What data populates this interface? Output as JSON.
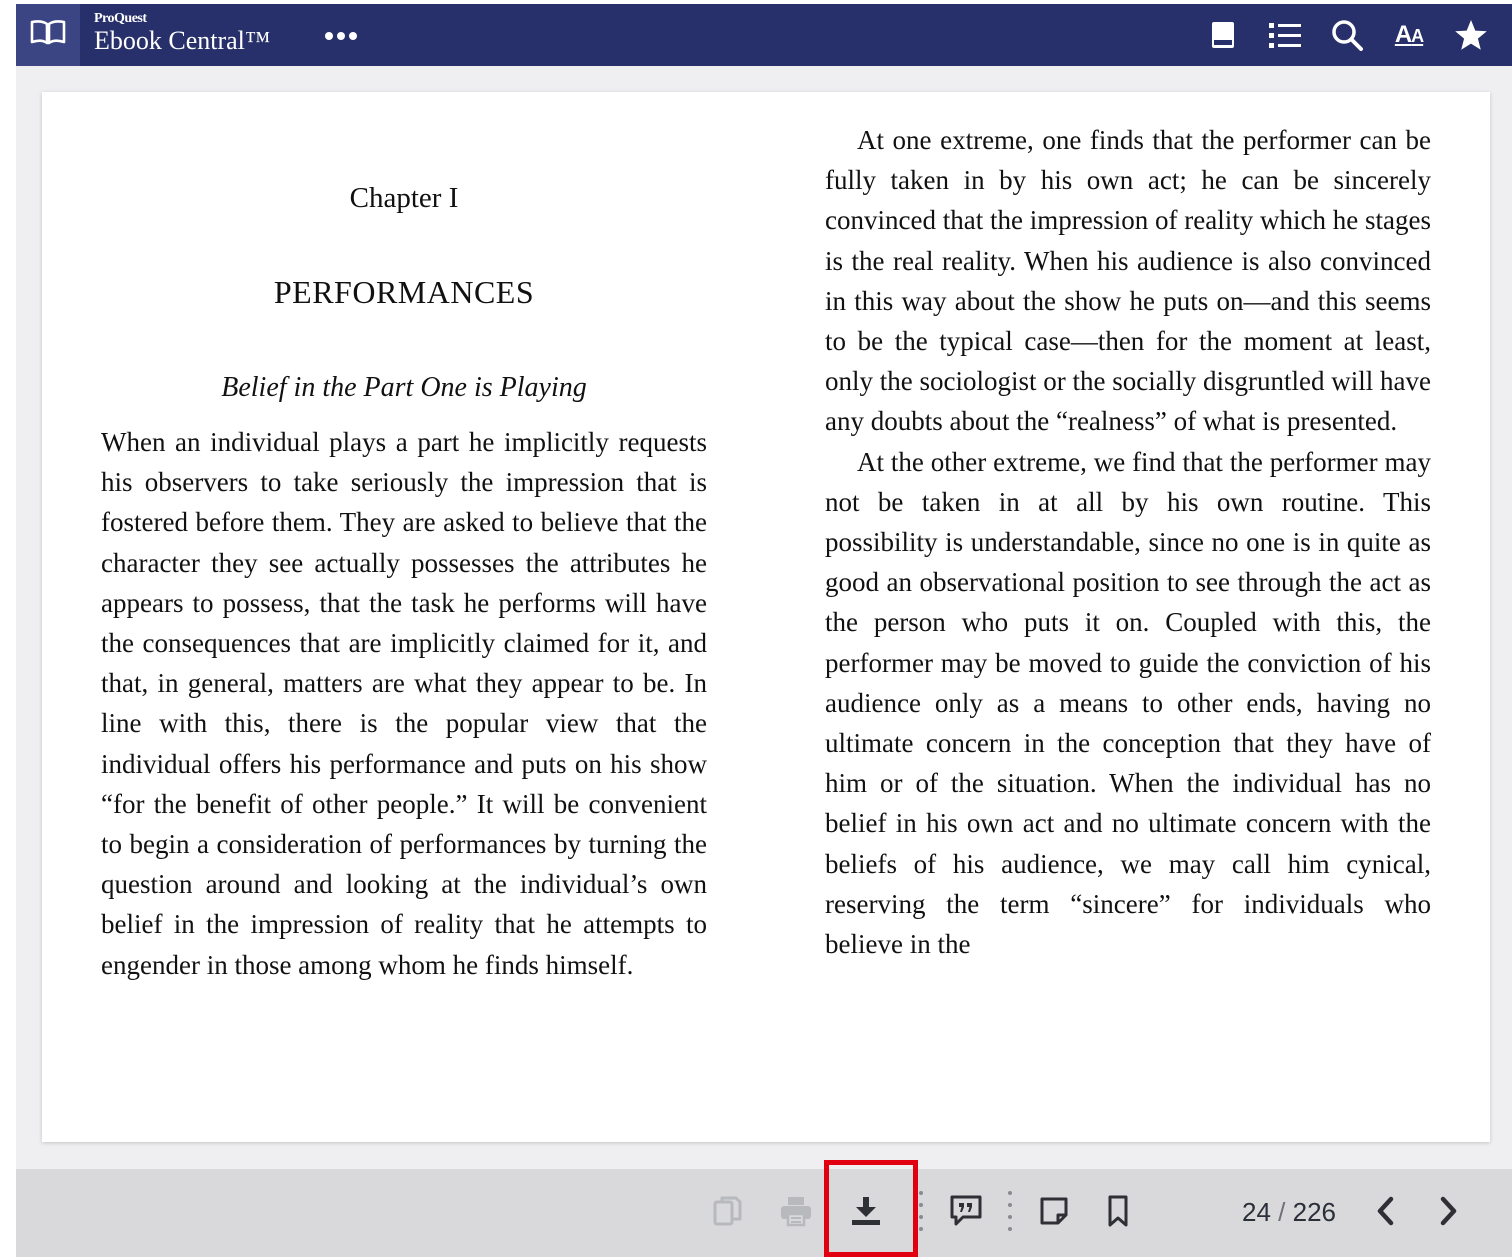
{
  "header": {
    "brand_small": "ProQuest",
    "brand_big": "Ebook Central™",
    "more_label": "•••",
    "icons": [
      "book-view-icon",
      "table-of-contents-icon",
      "search-icon",
      "text-size-icon",
      "favorite-star-icon"
    ],
    "text_size_label": "A",
    "text_size_label_small": "A"
  },
  "page": {
    "chapter_number": "Chapter I",
    "chapter_title": "PERFORMANCES",
    "section_title": "Belief in the Part One is Playing",
    "left_paragraph": "When an individual plays a part he implicitly requests his observers to take seriously the impression that is fostered before them. They are asked to believe that the character they see actually possesses the attributes he appears to possess, that the task he performs will have the consequences that are implicitly claimed for it, and that, in general, matters are what they appear to be. In line with this, there is the popular view that the individual offers his performance and puts on his show “for the benefit of other people.” It will be convenient to begin a consideration of performances by turning the question around and looking at the individual’s own belief in the impression of reality that he attempts to engender in those among whom he finds himself.",
    "right_paragraph_1": "At one extreme, one finds that the performer can be fully taken in by his own act; he can be sincerely convinced that the impression of reality which he stages is the real reality. When his audience is also convinced in this way about the show he puts on—and this seems to be the typical case—then for the moment at least, only the sociologist or the socially disgruntled will have any doubts about the “realness” of what is presented.",
    "right_paragraph_2": "At the other extreme, we find that the performer may not be taken in at all by his own routine. This possibility is understandable, since no one is in quite as good an observational position to see through the act as the person who puts it on. Coupled with this, the performer may be moved to guide the conviction of his audience only as a means to other ends, having no ultimate concern in the conception that they have of him or of the situation. When the individual has no belief in his own act and no ultimate concern with the beliefs of his audience, we may call him cynical, reserving the term “sincere” for individuals who believe in the"
  },
  "toolbar": {
    "icons": [
      "copy-icon",
      "print-icon",
      "download-icon",
      "cite-icon",
      "note-icon",
      "bookmark-icon",
      "previous-page-icon",
      "next-page-icon"
    ],
    "current_page": "24",
    "slash": "/",
    "total_pages": "226"
  },
  "colors": {
    "header_bg": "#27306a",
    "book_button_bg": "#3b4583",
    "toolbar_bg": "#d9d9db",
    "highlight_border": "#e0000f"
  }
}
